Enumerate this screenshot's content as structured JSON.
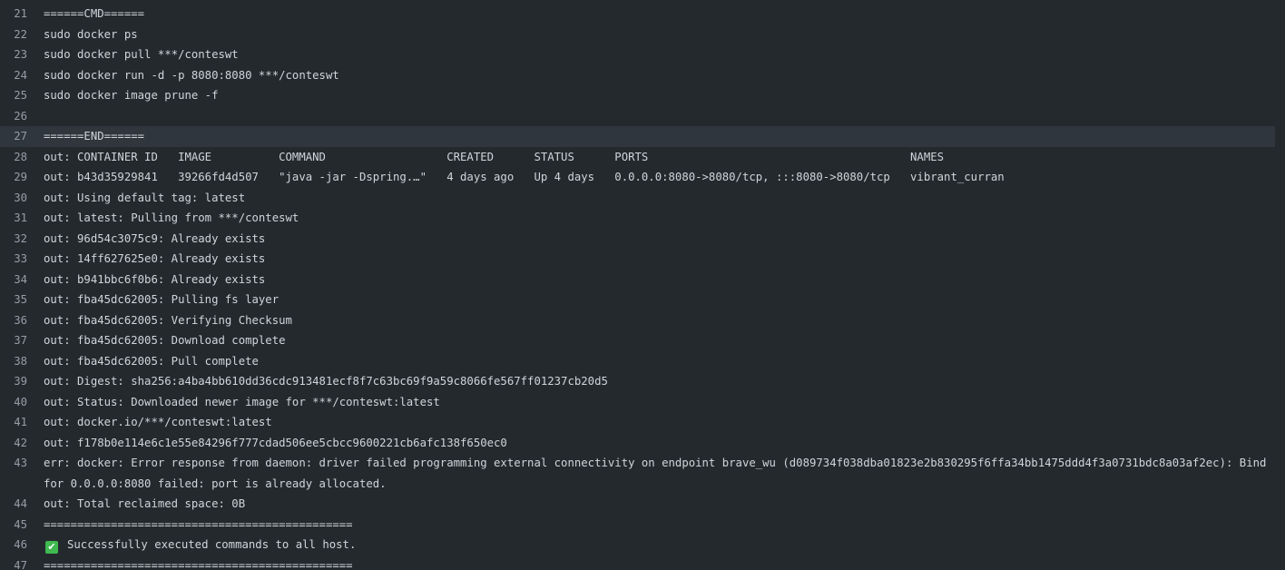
{
  "log": {
    "lines": [
      {
        "num": "21",
        "text": "======CMD======"
      },
      {
        "num": "22",
        "text": "sudo docker ps"
      },
      {
        "num": "23",
        "text": "sudo docker pull ***/conteswt"
      },
      {
        "num": "24",
        "text": "sudo docker run -d -p 8080:8080 ***/conteswt"
      },
      {
        "num": "25",
        "text": "sudo docker image prune -f"
      },
      {
        "num": "26",
        "text": ""
      },
      {
        "num": "27",
        "text": "======END======",
        "selected": true
      },
      {
        "num": "28",
        "text": "out: CONTAINER ID   IMAGE          COMMAND                  CREATED      STATUS      PORTS                                       NAMES"
      },
      {
        "num": "29",
        "text": "out: b43d35929841   39266fd4d507   \"java -jar -Dspring.…\"   4 days ago   Up 4 days   0.0.0.0:8080->8080/tcp, :::8080->8080/tcp   vibrant_curran"
      },
      {
        "num": "30",
        "text": "out: Using default tag: latest"
      },
      {
        "num": "31",
        "text": "out: latest: Pulling from ***/conteswt"
      },
      {
        "num": "32",
        "text": "out: 96d54c3075c9: Already exists"
      },
      {
        "num": "33",
        "text": "out: 14ff627625e0: Already exists"
      },
      {
        "num": "34",
        "text": "out: b941bbc6f0b6: Already exists"
      },
      {
        "num": "35",
        "text": "out: fba45dc62005: Pulling fs layer"
      },
      {
        "num": "36",
        "text": "out: fba45dc62005: Verifying Checksum"
      },
      {
        "num": "37",
        "text": "out: fba45dc62005: Download complete"
      },
      {
        "num": "38",
        "text": "out: fba45dc62005: Pull complete"
      },
      {
        "num": "39",
        "text": "out: Digest: sha256:a4ba4bb610dd36cdc913481ecf8f7c63bc69f9a59c8066fe567ff01237cb20d5"
      },
      {
        "num": "40",
        "text": "out: Status: Downloaded newer image for ***/conteswt:latest"
      },
      {
        "num": "41",
        "text": "out: docker.io/***/conteswt:latest"
      },
      {
        "num": "42",
        "text": "out: f178b0e114e6c1e55e84296f777cdad506ee5cbcc9600221cb6afc138f650ec0"
      },
      {
        "num": "43",
        "text": "err: docker: Error response from daemon: driver failed programming external connectivity on endpoint brave_wu (d089734f038dba01823e2b830295f6ffa34bb1475ddd4f3a0731bdc8a03af2ec): Bind for 0.0.0.0:8080 failed: port is already allocated."
      },
      {
        "num": "44",
        "text": "out: Total reclaimed space: 0B"
      },
      {
        "num": "45",
        "text": "=============================================="
      },
      {
        "num": "46",
        "text": "Successfully executed commands to all host.",
        "icon": "check-mark-icon"
      },
      {
        "num": "47",
        "text": "=============================================="
      }
    ]
  },
  "colors": {
    "background": "#24292e",
    "selected_line": "#2f363d",
    "text": "#d1d5da",
    "line_number": "#959da5",
    "success_icon": "#3fb950"
  }
}
